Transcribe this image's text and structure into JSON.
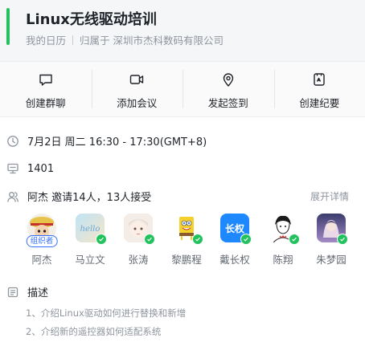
{
  "header": {
    "title": "Linux无线驱动培训",
    "calendar": "我的日历",
    "owner": "归属于 深圳市杰科数码有限公司"
  },
  "actions": [
    {
      "label": "创建群聊",
      "icon": "chat-bubble-icon"
    },
    {
      "label": "添加会议",
      "icon": "video-camera-icon"
    },
    {
      "label": "发起签到",
      "icon": "location-pin-icon"
    },
    {
      "label": "创建纪要",
      "icon": "notes-icon"
    }
  ],
  "event": {
    "time": "7月2日 周二 16:30 - 17:30(GMT+8)",
    "room": "1401",
    "invite_summary": "阿杰 邀请14人，13人接受",
    "expand_label": "展开详情"
  },
  "attendees": [
    {
      "name": "阿杰",
      "badge": "组织者",
      "accepted": true
    },
    {
      "name": "马立文",
      "avatar_text": "hello",
      "accepted": true
    },
    {
      "name": "张涛",
      "accepted": true
    },
    {
      "name": "黎鹏程",
      "accepted": true
    },
    {
      "name": "戴长权",
      "avatar_text": "长权",
      "accepted": true
    },
    {
      "name": "陈翔",
      "accepted": true
    },
    {
      "name": "朱梦园",
      "accepted": true
    }
  ],
  "description": {
    "title": "描述",
    "lines": [
      "1、介绍Linux驱动如何进行替换和新增",
      "2、介绍新的遥控器如何适配系统"
    ]
  },
  "colors": {
    "accent": "#22c35e",
    "organizer_badge": "#3370ff",
    "muted_text": "#8f959e"
  }
}
